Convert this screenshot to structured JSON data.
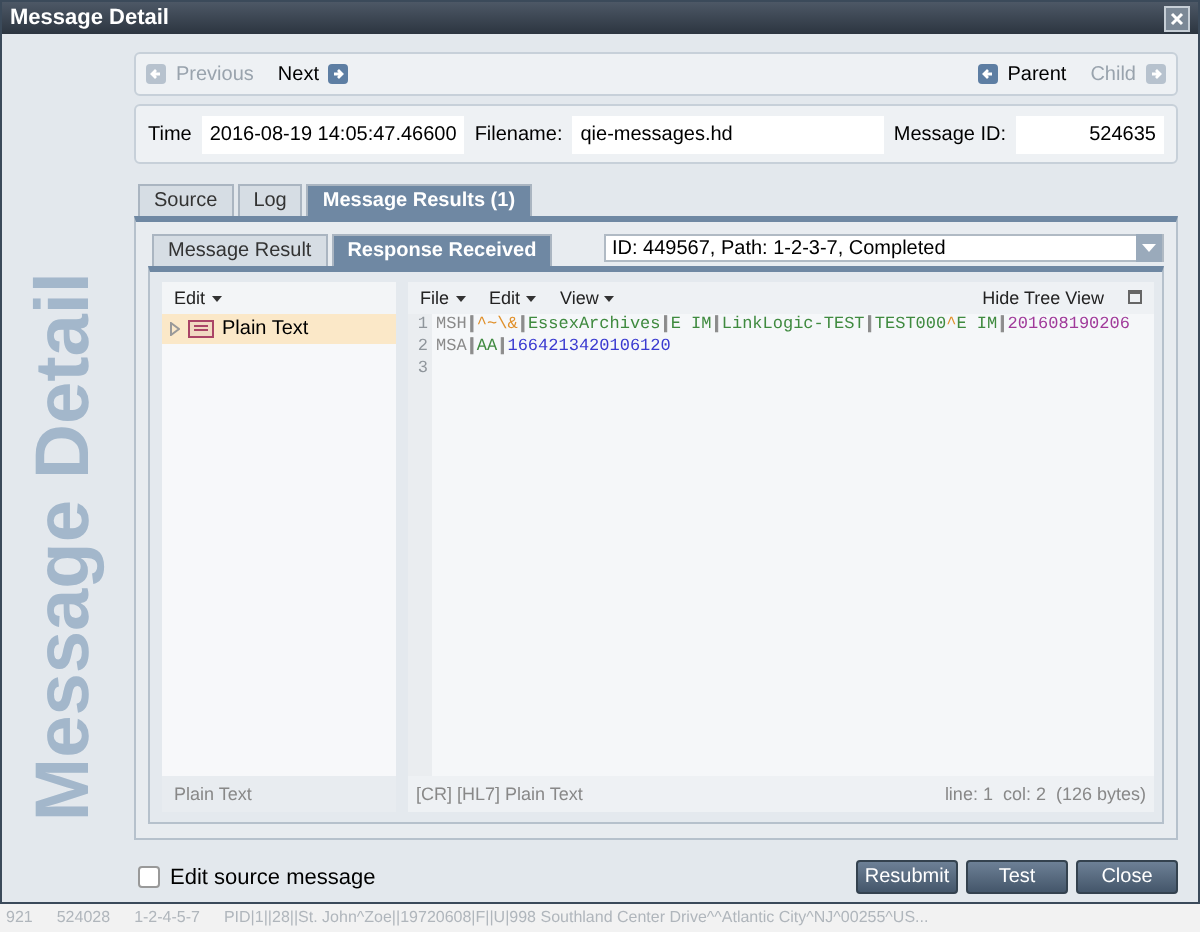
{
  "window": {
    "title": "Message Detail",
    "side_title": "Message Detail"
  },
  "nav": {
    "previous": {
      "label": "Previous",
      "disabled": true
    },
    "next": {
      "label": "Next",
      "disabled": false
    },
    "parent": {
      "label": "Parent",
      "disabled": false
    },
    "child": {
      "label": "Child",
      "disabled": true
    }
  },
  "info": {
    "time_label": "Time",
    "time": "2016-08-19 14:05:47.46600",
    "filename_label": "Filename:",
    "filename": "qie-messages.hd",
    "message_id_label": "Message ID:",
    "message_id": "524635"
  },
  "tabs": [
    {
      "label": "Source",
      "selected": false
    },
    {
      "label": "Log",
      "selected": false
    },
    {
      "label": "Message Results (1)",
      "selected": true
    }
  ],
  "subtabs": [
    {
      "label": "Message Result",
      "selected": false
    },
    {
      "label": "Response Received",
      "selected": true
    }
  ],
  "result_select": {
    "value": "ID: 449567, Path: 1-2-3-7, Completed"
  },
  "tree": {
    "menu": "Edit",
    "items": [
      {
        "label": "Plain Text",
        "selected": true,
        "expanded": false
      }
    ],
    "footer": "Plain Text"
  },
  "editor": {
    "menus": [
      "File",
      "Edit",
      "View"
    ],
    "hide_tree": "Hide Tree View",
    "lines": [
      {
        "number": "1",
        "tokens": [
          {
            "text": "MSH",
            "color": "#8a8a8a"
          },
          {
            "text": "|",
            "color": "#8c8c8c",
            "kind": "separator"
          },
          {
            "text": "^~\\&",
            "color": "#e0902a"
          },
          {
            "text": "|",
            "color": "#8c8c8c",
            "kind": "separator"
          },
          {
            "text": "EssexArchives",
            "color": "#3f8a3f"
          },
          {
            "text": "|",
            "color": "#8c8c8c",
            "kind": "separator"
          },
          {
            "text": "E IM",
            "color": "#3f8a3f"
          },
          {
            "text": "|",
            "color": "#8c8c8c",
            "kind": "separator"
          },
          {
            "text": "LinkLogic-TEST",
            "color": "#3f8a3f"
          },
          {
            "text": "|",
            "color": "#8c8c8c",
            "kind": "separator"
          },
          {
            "text": "TEST000",
            "color": "#3f8a3f"
          },
          {
            "text": "^",
            "color": "#e0902a"
          },
          {
            "text": "E IM",
            "color": "#3f8a3f"
          },
          {
            "text": "|",
            "color": "#8c8c8c",
            "kind": "separator"
          },
          {
            "text": "201608190206",
            "color": "#a03a9a"
          }
        ]
      },
      {
        "number": "2",
        "tokens": [
          {
            "text": "MSA",
            "color": "#8a8a8a"
          },
          {
            "text": "|",
            "color": "#8c8c8c",
            "kind": "separator"
          },
          {
            "text": "AA",
            "color": "#3f8a3f"
          },
          {
            "text": "|",
            "color": "#8c8c8c",
            "kind": "separator"
          },
          {
            "text": "1664213420106120",
            "color": "#3a3ad0"
          }
        ]
      },
      {
        "number": "3"
      }
    ],
    "status_left": "[CR] [HL7] Plain Text",
    "status_right": "line: 1  col: 2  (126 bytes)"
  },
  "edit_source": {
    "label": "Edit source message",
    "checked": false
  },
  "buttons": [
    "Resubmit",
    "Test",
    "Close"
  ],
  "background_row": [
    "921",
    "524028",
    "1-2-4-5-7",
    "PID|1||28||St. John^Zoe||19720608|F||U|998 Southland Center Drive^^Atlantic City^NJ^00255^US..."
  ]
}
